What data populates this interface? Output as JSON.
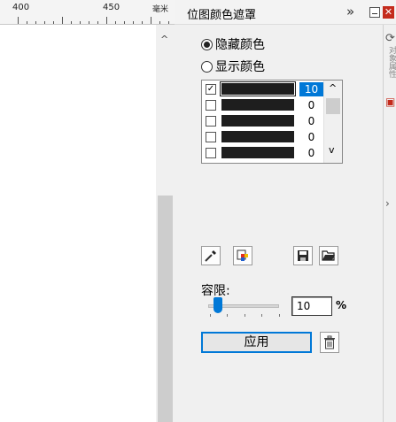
{
  "ruler": {
    "labels": [
      "400",
      "450"
    ],
    "unit": "毫米"
  },
  "panel": {
    "title": "位图颜色遮罩",
    "expand_glyph": "»",
    "close_glyph": "✕"
  },
  "modes": [
    {
      "label": "隐藏颜色",
      "selected": true
    },
    {
      "label": "显示颜色",
      "selected": false
    }
  ],
  "color_list": {
    "rows": [
      {
        "checked": true,
        "color": "#1e1e1e",
        "value": "10",
        "selected": true
      },
      {
        "checked": false,
        "color": "#1e1e1e",
        "value": "0",
        "selected": false
      },
      {
        "checked": false,
        "color": "#1e1e1e",
        "value": "0",
        "selected": false
      },
      {
        "checked": false,
        "color": "#1e1e1e",
        "value": "0",
        "selected": false
      },
      {
        "checked": false,
        "color": "#1e1e1e",
        "value": "0",
        "selected": false
      }
    ]
  },
  "tolerance": {
    "label": "容限:",
    "value": "10",
    "unit": "%"
  },
  "apply_label": "应用",
  "sidebar": {
    "text": "对象属性"
  },
  "colors": {
    "accent": "#0078d7",
    "close_red": "#c42b1c",
    "swatch": "#1e1e1e"
  }
}
